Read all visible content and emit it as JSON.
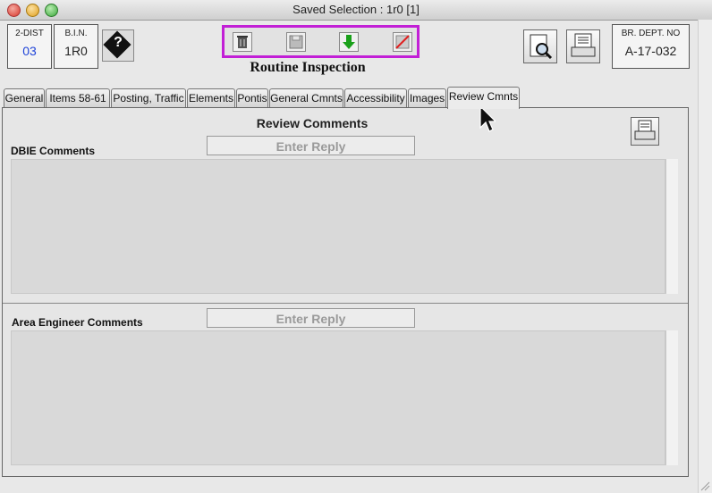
{
  "window": {
    "title": "Saved Selection : 1r0 [1]"
  },
  "fields": {
    "dist": {
      "label": "2-DIST",
      "value": "03"
    },
    "bin": {
      "label": "B.I.N.",
      "value": "1R0"
    },
    "dept": {
      "label": "BR. DEPT. NO",
      "value": "A-17-032"
    }
  },
  "form": {
    "title": "Routine Inspection"
  },
  "tabs": [
    {
      "label": "General"
    },
    {
      "label": "Items 58-61"
    },
    {
      "label": "Posting, Traffic"
    },
    {
      "label": "Elements"
    },
    {
      "label": "Pontis"
    },
    {
      "label": "General Cmnts"
    },
    {
      "label": "Accessibility"
    },
    {
      "label": "Images"
    },
    {
      "label": "Review Cmnts"
    }
  ],
  "active_tab": "Review Cmnts",
  "review": {
    "heading": "Review Comments",
    "dbie_label": "DBIE Comments",
    "area_label": "Area Engineer Comments",
    "reply_label": "Enter Reply"
  },
  "colors": {
    "toolbar_border": "#c21fd6",
    "field_blue": "#1f44d8"
  },
  "icons": [
    "help-icon",
    "trash-icon",
    "save-icon",
    "download-icon",
    "cancel-icon",
    "preview-icon",
    "print-icon"
  ]
}
